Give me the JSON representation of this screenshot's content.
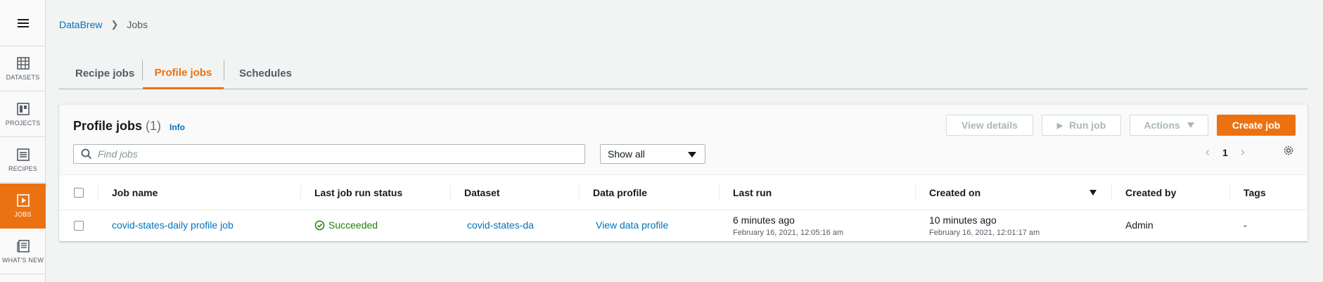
{
  "rail": {
    "items": [
      {
        "label": "DATASETS",
        "icon": "table-icon"
      },
      {
        "label": "PROJECTS",
        "icon": "grid-icon"
      },
      {
        "label": "RECIPES",
        "icon": "list-icon"
      },
      {
        "label": "JOBS",
        "icon": "play-icon",
        "active": true
      },
      {
        "label": "WHAT'S NEW",
        "icon": "news-icon"
      }
    ]
  },
  "breadcrumb": {
    "root": "DataBrew",
    "current": "Jobs"
  },
  "tabs": [
    {
      "label": "Recipe jobs"
    },
    {
      "label": "Profile jobs",
      "active": true
    },
    {
      "label": "Schedules"
    }
  ],
  "panel": {
    "title": "Profile jobs",
    "count": "(1)",
    "info": "Info",
    "buttons": {
      "view_details": "View details",
      "run_job": "Run job",
      "actions": "Actions",
      "create_job": "Create job"
    },
    "search": {
      "placeholder": "Find jobs",
      "value": ""
    },
    "filter": {
      "selected": "Show all"
    },
    "page": "1"
  },
  "table": {
    "columns": [
      "Job name",
      "Last job run status",
      "Dataset",
      "Data profile",
      "Last run",
      "Created on",
      "Created by",
      "Tags"
    ],
    "rows": [
      {
        "job_name": "covid-states-daily profile job",
        "status": "Succeeded",
        "dataset": "covid-states-da",
        "data_profile": "View data profile",
        "last_run": "6 minutes ago",
        "last_run_date": "February 16, 2021, 12:05:16 am",
        "created_on": "10 minutes ago",
        "created_on_date": "February 16, 2021, 12:01:17 am",
        "created_by": "Admin",
        "tags": "-"
      }
    ]
  },
  "colors": {
    "accent": "#ec7211",
    "link": "#0073bb",
    "success": "#1d8102"
  }
}
